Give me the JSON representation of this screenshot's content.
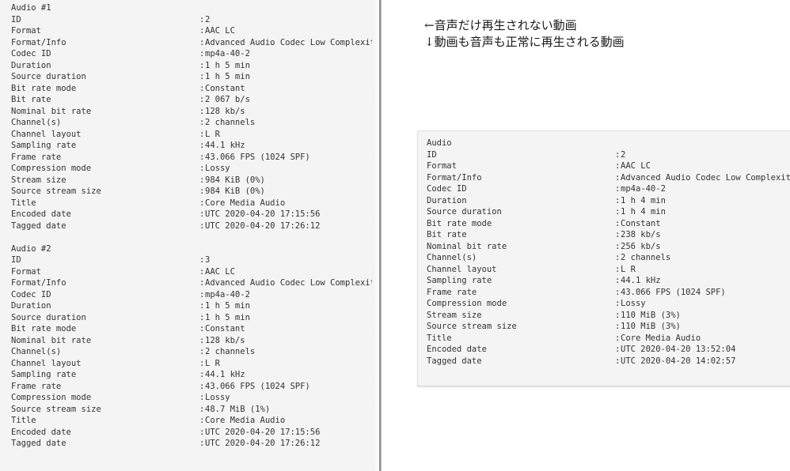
{
  "colors": {
    "panel_background": "#f4f4f4",
    "page_background": "#ffffff",
    "text": "#333333",
    "divider": "#8d8d8d",
    "box_border": "#e2e2e2"
  },
  "left_panel": {
    "blocks": [
      {
        "title": "Audio #1",
        "rows": [
          {
            "label": "ID",
            "separator": ":",
            "value": "2"
          },
          {
            "label": "Format",
            "separator": ":",
            "value": "AAC LC"
          },
          {
            "label": "Format/Info",
            "separator": ":",
            "value": "Advanced Audio Codec Low Complexity"
          },
          {
            "label": "Codec ID",
            "separator": ":",
            "value": "mp4a-40-2"
          },
          {
            "label": "Duration",
            "separator": ":",
            "value": "1 h 5 min"
          },
          {
            "label": "Source duration",
            "separator": ":",
            "value": "1 h 5 min"
          },
          {
            "label": "Bit rate mode",
            "separator": ":",
            "value": "Constant"
          },
          {
            "label": "Bit rate",
            "separator": ":",
            "value": "2 067 b/s"
          },
          {
            "label": "Nominal bit rate",
            "separator": ":",
            "value": "128 kb/s"
          },
          {
            "label": "Channel(s)",
            "separator": ":",
            "value": "2 channels"
          },
          {
            "label": "Channel layout",
            "separator": ":",
            "value": "L R"
          },
          {
            "label": "Sampling rate",
            "separator": ":",
            "value": "44.1 kHz"
          },
          {
            "label": "Frame rate",
            "separator": ":",
            "value": "43.066 FPS (1024 SPF)"
          },
          {
            "label": "Compression mode",
            "separator": ":",
            "value": "Lossy"
          },
          {
            "label": "Stream size",
            "separator": ":",
            "value": "984 KiB (0%)"
          },
          {
            "label": "Source stream size",
            "separator": ":",
            "value": "984 KiB (0%)"
          },
          {
            "label": "Title",
            "separator": ":",
            "value": "Core Media Audio"
          },
          {
            "label": "Encoded date",
            "separator": ":",
            "value": "UTC 2020-04-20 17:15:56"
          },
          {
            "label": "Tagged date",
            "separator": ":",
            "value": "UTC 2020-04-20 17:26:12"
          }
        ]
      },
      {
        "title": "Audio #2",
        "rows": [
          {
            "label": "ID",
            "separator": ":",
            "value": "3"
          },
          {
            "label": "Format",
            "separator": ":",
            "value": "AAC LC"
          },
          {
            "label": "Format/Info",
            "separator": ":",
            "value": "Advanced Audio Codec Low Complexity"
          },
          {
            "label": "Codec ID",
            "separator": ":",
            "value": "mp4a-40-2"
          },
          {
            "label": "Duration",
            "separator": ":",
            "value": "1 h 5 min"
          },
          {
            "label": "Source duration",
            "separator": ":",
            "value": "1 h 5 min"
          },
          {
            "label": "Bit rate mode",
            "separator": ":",
            "value": "Constant"
          },
          {
            "label": "Nominal bit rate",
            "separator": ":",
            "value": "128 kb/s"
          },
          {
            "label": "Channel(s)",
            "separator": ":",
            "value": "2 channels"
          },
          {
            "label": "Channel layout",
            "separator": ":",
            "value": "L R"
          },
          {
            "label": "Sampling rate",
            "separator": ":",
            "value": "44.1 kHz"
          },
          {
            "label": "Frame rate",
            "separator": ":",
            "value": "43.066 FPS (1024 SPF)"
          },
          {
            "label": "Compression mode",
            "separator": ":",
            "value": "Lossy"
          },
          {
            "label": "Source stream size",
            "separator": ":",
            "value": "48.7 MiB (1%)"
          },
          {
            "label": "Title",
            "separator": ":",
            "value": "Core Media Audio"
          },
          {
            "label": "Encoded date",
            "separator": ":",
            "value": "UTC 2020-04-20 17:15:56"
          },
          {
            "label": "Tagged date",
            "separator": ":",
            "value": "UTC 2020-04-20 17:26:12"
          }
        ]
      }
    ]
  },
  "annotation": {
    "lines": [
      "←音声だけ再生されない動画",
      "↓動画も音声も正常に再生される動画"
    ]
  },
  "right_panel": {
    "blocks": [
      {
        "title": "Audio",
        "rows": [
          {
            "label": "ID",
            "separator": ":",
            "value": "2"
          },
          {
            "label": "Format",
            "separator": ":",
            "value": "AAC LC"
          },
          {
            "label": "Format/Info",
            "separator": ":",
            "value": "Advanced Audio Codec Low Complexity"
          },
          {
            "label": "Codec ID",
            "separator": ":",
            "value": "mp4a-40-2"
          },
          {
            "label": "Duration",
            "separator": ":",
            "value": "1 h 4 min"
          },
          {
            "label": "Source duration",
            "separator": ":",
            "value": "1 h 4 min"
          },
          {
            "label": "Bit rate mode",
            "separator": ":",
            "value": "Constant"
          },
          {
            "label": "Bit rate",
            "separator": ":",
            "value": "238 kb/s"
          },
          {
            "label": "Nominal bit rate",
            "separator": ":",
            "value": "256 kb/s"
          },
          {
            "label": "Channel(s)",
            "separator": ":",
            "value": "2 channels"
          },
          {
            "label": "Channel layout",
            "separator": ":",
            "value": "L R"
          },
          {
            "label": "Sampling rate",
            "separator": ":",
            "value": "44.1 kHz"
          },
          {
            "label": "Frame rate",
            "separator": ":",
            "value": "43.066 FPS (1024 SPF)"
          },
          {
            "label": "Compression mode",
            "separator": ":",
            "value": "Lossy"
          },
          {
            "label": "Stream size",
            "separator": ":",
            "value": "110 MiB (3%)"
          },
          {
            "label": "Source stream size",
            "separator": ":",
            "value": "110 MiB (3%)"
          },
          {
            "label": "Title",
            "separator": ":",
            "value": "Core Media Audio"
          },
          {
            "label": "Encoded date",
            "separator": ":",
            "value": "UTC 2020-04-20 13:52:04"
          },
          {
            "label": "Tagged date",
            "separator": ":",
            "value": "UTC 2020-04-20 14:02:57"
          }
        ]
      }
    ]
  }
}
